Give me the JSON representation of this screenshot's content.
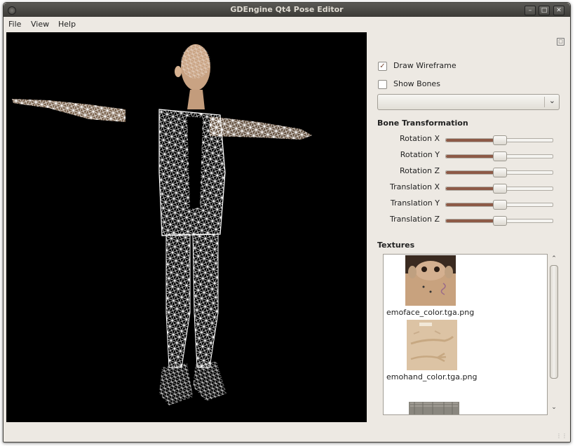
{
  "window": {
    "title": "GDEngine Qt4 Pose Editor"
  },
  "menubar": {
    "items": [
      "File",
      "View",
      "Help"
    ]
  },
  "panel": {
    "draw_wireframe": {
      "label": "Draw Wireframe",
      "checked": true
    },
    "show_bones": {
      "label": "Show Bones",
      "checked": false
    },
    "bone_select": {
      "value": ""
    },
    "bone_transformation_title": "Bone Transformation",
    "sliders": [
      {
        "label": "Rotation X",
        "value": 0.5
      },
      {
        "label": "Rotation Y",
        "value": 0.5
      },
      {
        "label": "Rotation Z",
        "value": 0.5
      },
      {
        "label": "Translation X",
        "value": 0.5
      },
      {
        "label": "Translation Y",
        "value": 0.5
      },
      {
        "label": "Translation Z",
        "value": 0.5
      }
    ],
    "textures_title": "Textures",
    "textures": [
      {
        "name": "emoface_color.tga.png"
      },
      {
        "name": "emohand_color.tga.png"
      },
      {
        "name": ""
      }
    ]
  },
  "colors": {
    "accent": "#8d5a47",
    "viewport_bg": "#000000",
    "wire": "#ffffff",
    "skin": "#d9b08c"
  }
}
